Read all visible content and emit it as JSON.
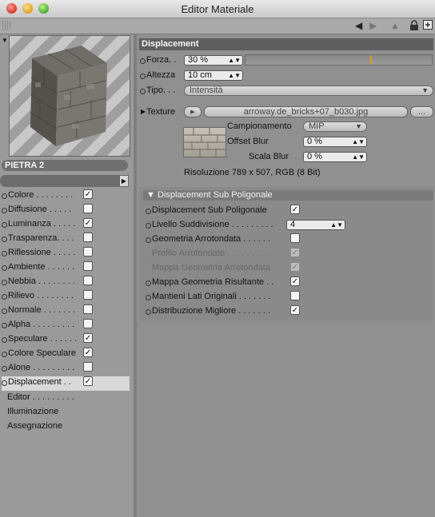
{
  "window": {
    "title": "Editor Materiale"
  },
  "toolbar": {
    "icons": [
      "arrow-left-icon",
      "arrow-right-icon",
      "arrow-up-icon",
      "lock-icon",
      "new-window-icon"
    ]
  },
  "material": {
    "name": "PIETRA 2"
  },
  "channels": [
    {
      "label": "Colore . . . . . . . .",
      "checked": true
    },
    {
      "label": "Diffusione . . . . .",
      "checked": false
    },
    {
      "label": "Luminanza . . . . .",
      "checked": true
    },
    {
      "label": "Trasparenza. . . .",
      "checked": false
    },
    {
      "label": "Riflessione . . . . .",
      "checked": false
    },
    {
      "label": "Ambiente . . . . . .",
      "checked": false
    },
    {
      "label": "Nebbia . . . . . . . .",
      "checked": false
    },
    {
      "label": "Rilievo . . . . . . . .",
      "checked": false
    },
    {
      "label": "Normale . . . . . . .",
      "checked": false
    },
    {
      "label": "Alpha . . . . . . . . .",
      "checked": false
    },
    {
      "label": "Speculare . . . . . .",
      "checked": true
    },
    {
      "label": "Colore Speculare",
      "checked": true
    },
    {
      "label": "Alone . . . . . . . . .",
      "checked": false
    },
    {
      "label": "Displacement . .",
      "checked": true,
      "active": true
    }
  ],
  "extras": [
    "Editor . . . . . . . . .",
    "Illuminazione",
    "Assegnazione"
  ],
  "displacement": {
    "header": "Displacement",
    "forza_label": "Forza. .",
    "forza_value": "30 %",
    "altezza_label": "Altezza",
    "altezza_value": "10 cm",
    "tipo_label": "Tipo. . .",
    "tipo_value": "Intensità",
    "texture_label": "Texture",
    "texture_file": "arroway.de_bricks+07_b030.jpg",
    "texture_more": "...",
    "campionamento_label": "Campionamento",
    "campionamento_value": "MIP",
    "offset_blur_label": "Offset Blur",
    "offset_blur_value": "0 %",
    "scala_blur_label": "Scala Blur",
    "scala_blur_value": "0 %",
    "resolution": "Risoluzione 789 x 507, RGB (8 Bit)"
  },
  "subpoly": {
    "header": "Displacement Sub Poligonale",
    "rows": [
      {
        "label": "Displacement Sub Poligonale",
        "checked": true,
        "disabled": false
      },
      {
        "label": "Livello Suddivisione . . . . . . . . .",
        "value": "4"
      },
      {
        "label": "Geometria Arrotondata . . . . . .",
        "checked": false,
        "disabled": false
      },
      {
        "label": "Profilo Arrotondato . . . . . . . . .",
        "checked": true,
        "disabled": true
      },
      {
        "label": "Mappa Geometria Arrotondata",
        "checked": true,
        "disabled": true
      },
      {
        "label": "Mappa Geometria Risultante . .",
        "checked": true,
        "disabled": false
      },
      {
        "label": "Mantieni Lati Originali . . . . . . .",
        "checked": false,
        "disabled": false
      },
      {
        "label": "Distribuzione Migliore . . . . . . .",
        "checked": true,
        "disabled": false
      }
    ]
  }
}
